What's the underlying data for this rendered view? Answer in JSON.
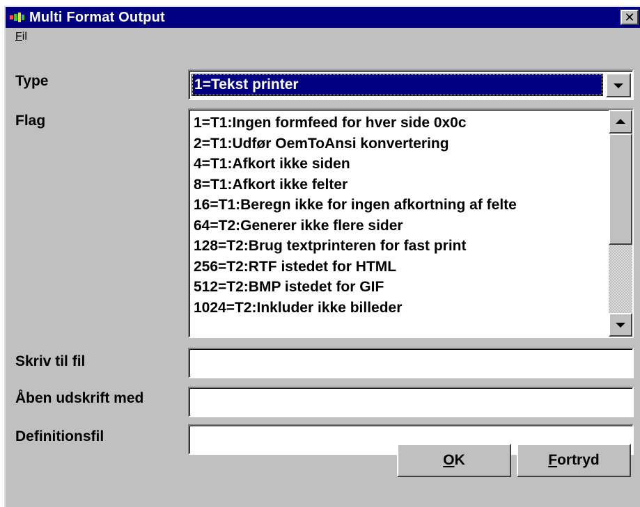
{
  "window": {
    "title": "Multi Format Output",
    "close_label": "✕",
    "colors": {
      "titlebar": "#000080",
      "face": "#c0c0c0",
      "selection": "#000080"
    }
  },
  "menu": {
    "fil_mnemonic": "F",
    "fil_rest": "il"
  },
  "type_field": {
    "label": "Type",
    "selected": "1=Tekst printer"
  },
  "flag_field": {
    "label": "Flag",
    "items": [
      "1=T1:Ingen formfeed for hver side 0x0c",
      "2=T1:Udfør OemToAnsi konvertering",
      "4=T1:Afkort ikke siden",
      "8=T1:Afkort ikke felter",
      "16=T1:Beregn ikke for ingen afkortning af felte",
      "64=T2:Generer ikke flere sider",
      "128=T2:Brug textprinteren for fast print",
      "256=T2:RTF istedet for HTML",
      "512=T2:BMP istedet for GIF",
      "1024=T2:Inkluder ikke billeder"
    ]
  },
  "skriv_field": {
    "label": "Skriv til fil",
    "value": ""
  },
  "aaben_field": {
    "label": "Åben udskrift med",
    "value": ""
  },
  "definitions_field": {
    "label": "Definitionsfil",
    "value": ""
  },
  "buttons": {
    "ok_mnemonic": "O",
    "ok_rest": "K",
    "cancel_mnemonic": "F",
    "cancel_rest": "ortryd"
  }
}
